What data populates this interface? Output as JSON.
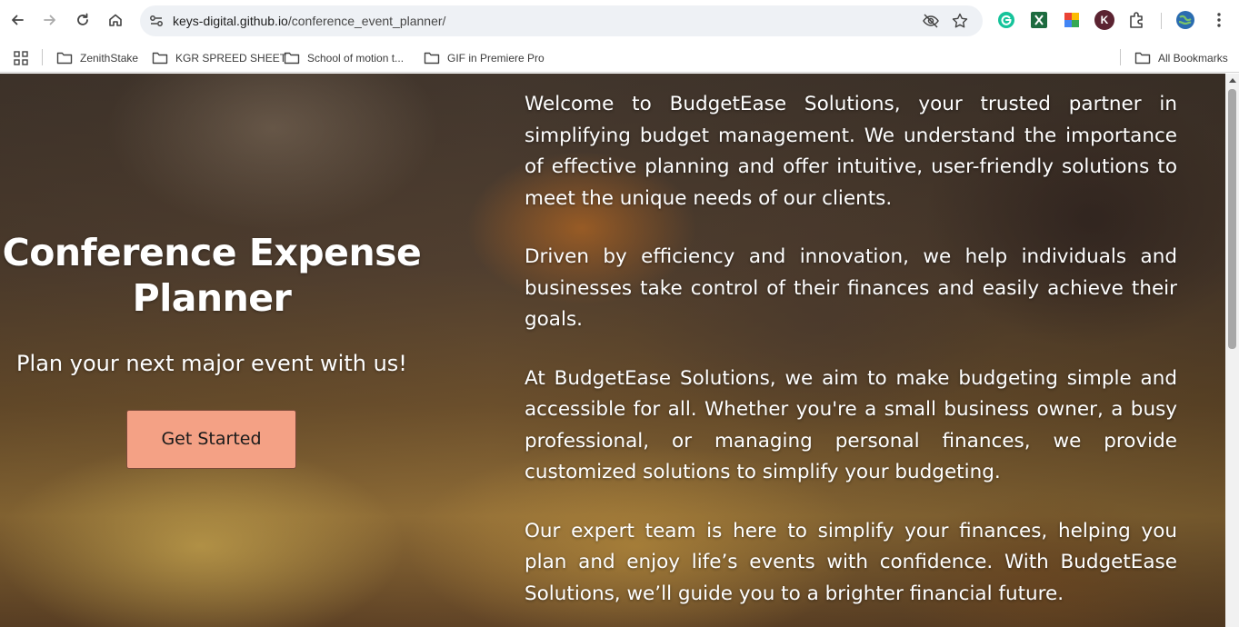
{
  "browser": {
    "url_domain": "keys-digital.github.io",
    "url_path": "/conference_event_planner/",
    "bookmarks": [
      "ZenithStake",
      "KGR SPREED SHEET",
      "School of motion t...",
      "GIF in Premiere Pro"
    ],
    "all_bookmarks_label": "All Bookmarks",
    "extension_k_letter": "K",
    "icons": [
      "back-arrow-icon",
      "forward-arrow-icon",
      "reload-icon",
      "home-icon",
      "site-info-icon",
      "eye-off-icon",
      "star-icon",
      "grammarly-icon",
      "extension-x-icon",
      "extension-color-icon",
      "profile-k-icon",
      "puzzle-icon",
      "avatar-globe-icon",
      "more-menu-icon",
      "apps-grid-icon",
      "folder-icon"
    ]
  },
  "hero": {
    "title_line1": "Conference Expense",
    "title_line2": "Planner",
    "subtitle": "Plan your next major event with us!",
    "cta_label": "Get Started",
    "cta_color": "#f4a185",
    "paragraphs": [
      "Welcome to BudgetEase Solutions, your trusted partner in simplifying budget management. We understand the importance of effective planning and offer intuitive, user-friendly solutions to meet the unique needs of our clients.",
      "Driven by efficiency and innovation, we help individuals and businesses take control of their finances and easily achieve their goals.",
      "At BudgetEase Solutions, we aim to make budgeting simple and accessible for all. Whether you're a small business owner, a busy professional, or managing personal finances, we provide customized solutions to simplify your budgeting.",
      "Our expert team is here to simplify your finances, helping you plan and enjoy life’s events with confidence. With BudgetEase Solutions, we’ll guide you to a brighter financial future."
    ]
  }
}
